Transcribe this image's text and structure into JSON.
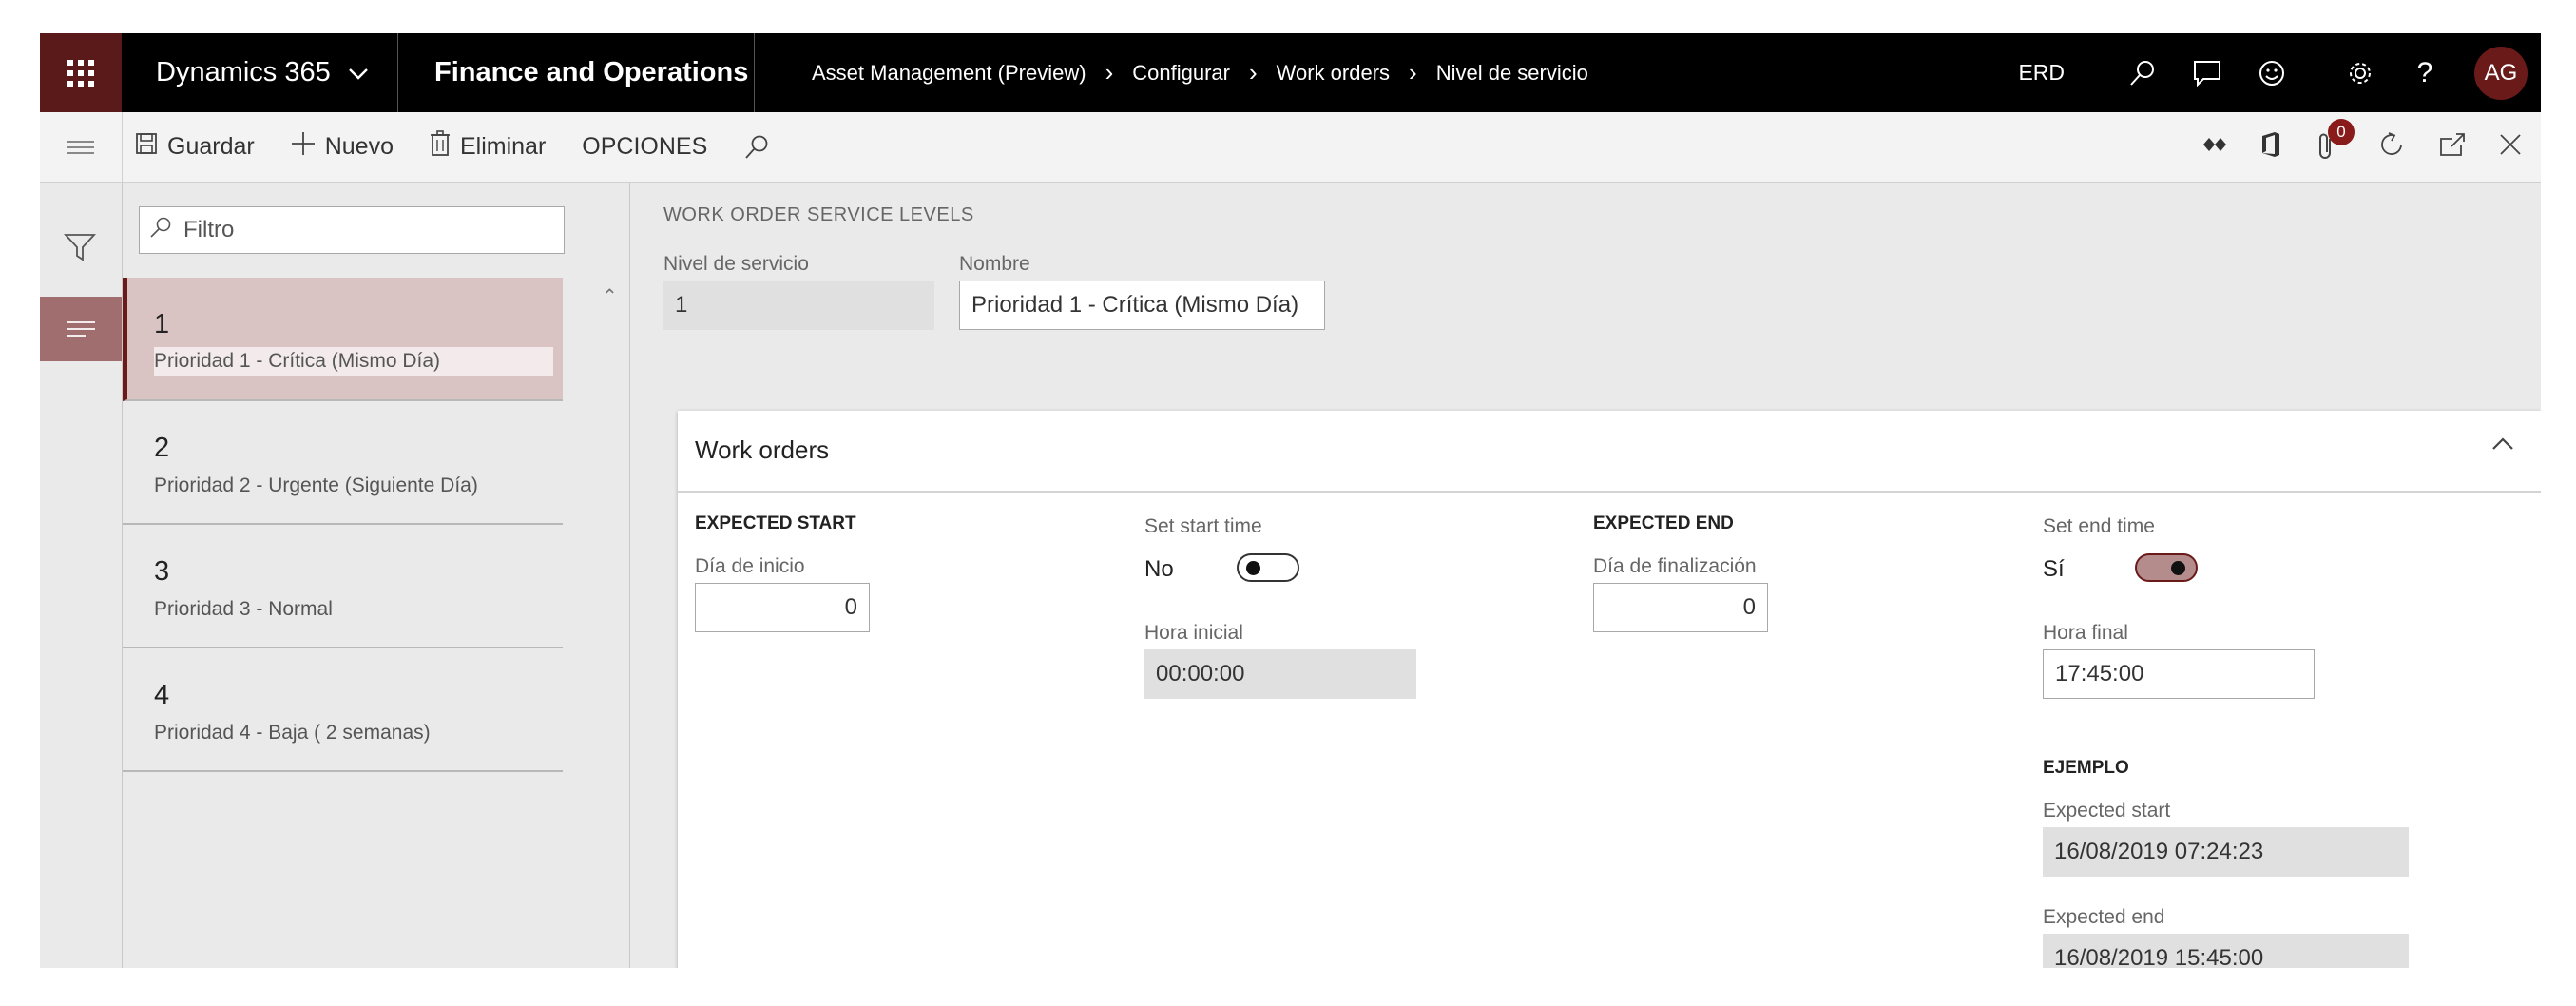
{
  "topbar": {
    "brand": "Dynamics 365",
    "module": "Finance and Operations",
    "breadcrumb": [
      "Asset Management (Preview)",
      "Configurar",
      "Work orders",
      "Nivel de servicio"
    ],
    "company": "ERD",
    "avatar_initials": "AG",
    "icons": [
      "waffle-icon",
      "search-icon",
      "message-icon",
      "smiley-icon",
      "gear-icon",
      "help-icon"
    ]
  },
  "actionbar": {
    "save_label": "Guardar",
    "new_label": "Nuevo",
    "delete_label": "Eliminar",
    "options_label": "OPCIONES",
    "attachments_count": "0"
  },
  "list": {
    "filter_placeholder": "Filtro",
    "items": [
      {
        "id": "1",
        "name": "Prioridad 1 - Crítica (Mismo Día)"
      },
      {
        "id": "2",
        "name": "Prioridad 2 - Urgente (Siguiente Día)"
      },
      {
        "id": "3",
        "name": "Prioridad 3 - Normal"
      },
      {
        "id": "4",
        "name": "Prioridad 4 - Baja ( 2 semanas)"
      }
    ]
  },
  "detail": {
    "caption": "WORK ORDER SERVICE LEVELS",
    "service_level_label": "Nivel de servicio",
    "service_level_value": "1",
    "name_label": "Nombre",
    "name_value": "Prioridad 1 - Crítica (Mismo Día)",
    "card": {
      "title": "Work orders",
      "expected_start_title": "EXPECTED START",
      "start_day_label": "Día de inicio",
      "start_day_value": "0",
      "set_start_time_label": "Set start time",
      "set_start_time_state": "No",
      "start_time_label": "Hora inicial",
      "start_time_value": "00:00:00",
      "expected_end_title": "EXPECTED END",
      "end_day_label": "Día de finalización",
      "end_day_value": "0",
      "set_end_time_label": "Set end time",
      "set_end_time_state": "Sí",
      "end_time_label": "Hora final",
      "end_time_value": "17:45:00",
      "example_title": "EJEMPLO",
      "example_start_label": "Expected start",
      "example_start_value": "16/08/2019 07:24:23",
      "example_end_label": "Expected end",
      "example_end_value": "16/08/2019 15:45:00"
    }
  },
  "colors": {
    "accent": "#6b1a1a",
    "selected_row": "#d9c3c3",
    "topbar": "#000000"
  }
}
